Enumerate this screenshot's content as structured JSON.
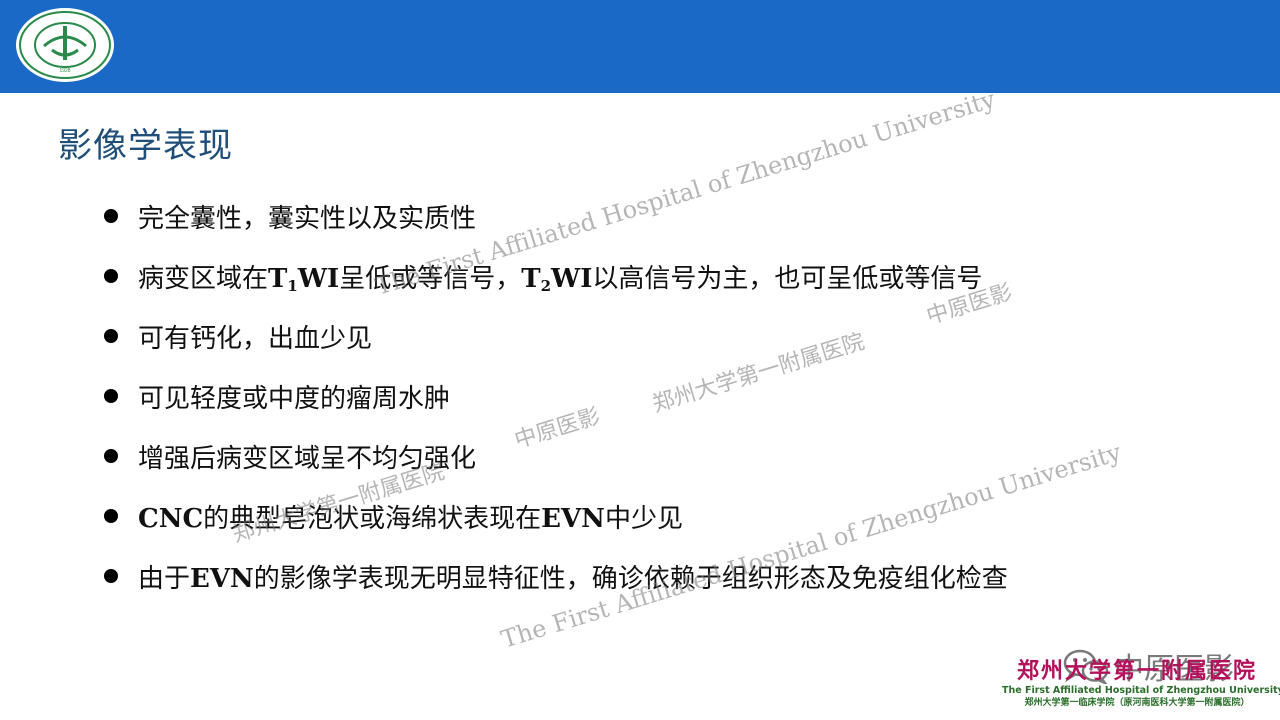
{
  "header": {
    "color": "#1b69c6",
    "logo": {
      "icon": "hospital-seal-icon",
      "ring_text": "郑州大学第一附属医院",
      "year": "1928"
    }
  },
  "title": "影像学表现",
  "bullets": [
    {
      "parts": [
        {
          "t": "完全囊性，囊实性以及实质性"
        }
      ]
    },
    {
      "parts": [
        {
          "t": "病变区域在"
        },
        {
          "t": "T",
          "b": true
        },
        {
          "t": "1",
          "sub": true,
          "b": true
        },
        {
          "t": "WI",
          "b": true
        },
        {
          "t": "呈低或等信号，"
        },
        {
          "t": "T",
          "b": true
        },
        {
          "t": "2",
          "sub": true,
          "b": true
        },
        {
          "t": "WI",
          "b": true
        },
        {
          "t": "以高信号为主，也可呈低或等信号"
        }
      ]
    },
    {
      "parts": [
        {
          "t": "可有钙化，出血少见"
        }
      ]
    },
    {
      "parts": [
        {
          "t": "可见轻度或中度的瘤周水肿"
        }
      ]
    },
    {
      "parts": [
        {
          "t": "增强后病变区域呈不均匀强化"
        }
      ]
    },
    {
      "parts": [
        {
          "t": "CNC",
          "b": true
        },
        {
          "t": "的典型皂泡状或海绵状表现在"
        },
        {
          "t": "EVN",
          "b": true
        },
        {
          "t": "中少见"
        }
      ]
    },
    {
      "parts": [
        {
          "t": "由于"
        },
        {
          "t": "EVN",
          "b": true
        },
        {
          "t": "的影像学表现无明显特征性，确诊依赖于组织形态及免疫组化检查"
        }
      ]
    }
  ],
  "watermarks": {
    "en": "The First Affiliated Hospital of Zhengzhou University",
    "cn_hospital": "郑州大学第一附属医院",
    "cn_brand": "中原医影"
  },
  "wechat": {
    "icon": "wechat-icon",
    "label": "中原医影"
  },
  "footer": {
    "cn": "郑州大学第一附属医院",
    "en": "The First Affiliated Hospital of Zhengzhou University",
    "sub": "郑州大学第一临床学院（原河南医科大学第一附属医院）",
    "cn_color": "#b5105b",
    "en_color": "#2a6e2a"
  }
}
